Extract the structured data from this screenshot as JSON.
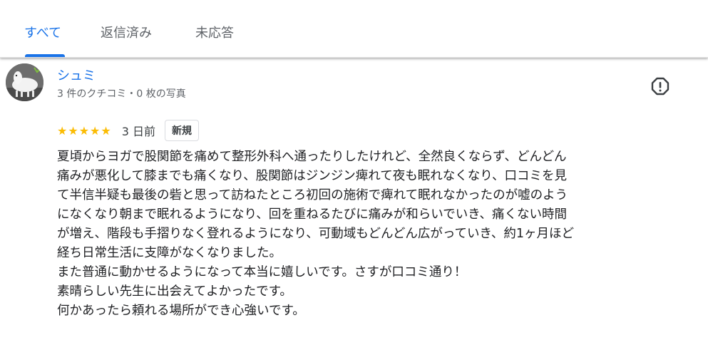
{
  "tabs": [
    {
      "label": "すべて",
      "active": true
    },
    {
      "label": "返信済み",
      "active": false
    },
    {
      "label": "未応答",
      "active": false
    }
  ],
  "review": {
    "reviewer_name": "シュミ",
    "reviewer_meta": "3 件のクチコミ・0 枚の写真",
    "rating": 5,
    "stars": "★★★★★",
    "date": "3 日前",
    "badge": "新規",
    "text_lines": [
      "夏頃からヨガで股関節を痛めて整形外科へ通ったりしたけれど、全然良くならず、どんどん",
      "痛みが悪化して膝までも痛くなり、股関節はジンジン痺れて夜も眠れなくなり、口コミを見",
      "て半信半疑も最後の砦と思って訪ねたところ初回の施術で痺れて眠れなかったのが嘘のよう",
      "になくなり朝まで眠れるようになり、回を重ねるたびに痛みが和らいでいき、痛くない時間",
      "が増え、階段も手摺りなく登れるようになり、可動域もどんどん広がっていき、約1ヶ月ほど",
      "経ち日常生活に支障がなくなりました。",
      "また普通に動かせるようになって本当に嬉しいです。さすが口コミ通り！",
      "素晴らしい先生に出会えてよかったです。",
      "何かあったら頼れる場所ができ心強いです。"
    ]
  },
  "colors": {
    "accent": "#1a73e8",
    "star": "#fbbc04",
    "secondary_text": "#5f6368"
  },
  "icons": {
    "report": "report-alert-icon",
    "avatar": "alpaca-avatar"
  }
}
